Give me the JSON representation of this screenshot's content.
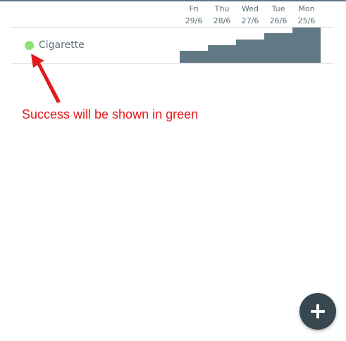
{
  "days": [
    {
      "name": "Fri",
      "date": "29/6",
      "level": 0.34
    },
    {
      "name": "Thu",
      "date": "28/6",
      "level": 0.5
    },
    {
      "name": "Wed",
      "date": "27/6",
      "level": 0.66
    },
    {
      "name": "Tue",
      "date": "26/6",
      "level": 0.84
    },
    {
      "name": "Mon",
      "date": "25/6",
      "level": 1.0
    }
  ],
  "habits": [
    {
      "name": "Cigarette",
      "status_color": "#8ee07a"
    }
  ],
  "annotation": {
    "text": "Success will be shown in green",
    "color": "#e11b1b"
  },
  "fab": {
    "icon": "plus-icon"
  },
  "colors": {
    "bar": "#607985",
    "text": "#5b6f79",
    "fab": "#37474f"
  }
}
